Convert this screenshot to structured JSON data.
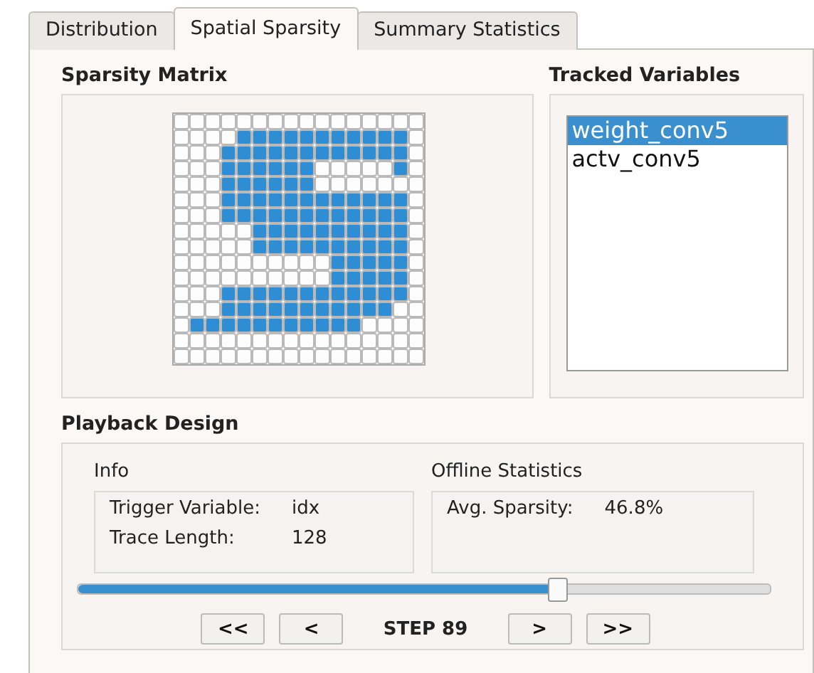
{
  "tabs": [
    {
      "label": "Distribution",
      "selected": false
    },
    {
      "label": "Spatial Sparsity",
      "selected": true
    },
    {
      "label": "Summary Statistics",
      "selected": false
    }
  ],
  "sparsity_matrix": {
    "title": "Sparsity Matrix",
    "cells": [
      [
        false,
        false,
        false,
        false,
        false,
        false,
        false,
        false,
        false,
        false,
        false,
        false,
        false,
        false,
        false,
        false
      ],
      [
        false,
        false,
        false,
        false,
        true,
        true,
        true,
        true,
        true,
        true,
        true,
        true,
        true,
        true,
        true,
        false
      ],
      [
        false,
        false,
        false,
        true,
        true,
        true,
        true,
        true,
        true,
        true,
        true,
        true,
        true,
        true,
        true,
        false
      ],
      [
        false,
        false,
        false,
        true,
        true,
        true,
        true,
        true,
        true,
        false,
        false,
        false,
        false,
        false,
        true,
        false
      ],
      [
        false,
        false,
        false,
        true,
        true,
        true,
        true,
        true,
        true,
        false,
        false,
        false,
        false,
        false,
        false,
        false
      ],
      [
        false,
        false,
        false,
        true,
        true,
        true,
        true,
        true,
        true,
        true,
        true,
        true,
        true,
        true,
        true,
        false
      ],
      [
        false,
        false,
        false,
        true,
        true,
        true,
        true,
        true,
        true,
        true,
        true,
        true,
        true,
        true,
        true,
        false
      ],
      [
        false,
        false,
        false,
        false,
        false,
        true,
        true,
        true,
        true,
        true,
        true,
        true,
        true,
        true,
        true,
        false
      ],
      [
        false,
        false,
        false,
        false,
        false,
        true,
        true,
        true,
        true,
        true,
        true,
        true,
        true,
        true,
        true,
        false
      ],
      [
        false,
        false,
        false,
        false,
        false,
        false,
        false,
        false,
        false,
        false,
        true,
        true,
        true,
        true,
        true,
        false
      ],
      [
        false,
        false,
        false,
        false,
        false,
        false,
        false,
        false,
        false,
        false,
        true,
        true,
        true,
        true,
        true,
        false
      ],
      [
        false,
        false,
        false,
        true,
        true,
        true,
        true,
        true,
        true,
        true,
        true,
        true,
        true,
        true,
        true,
        false
      ],
      [
        false,
        false,
        false,
        true,
        true,
        true,
        true,
        true,
        true,
        true,
        true,
        true,
        true,
        true,
        false,
        false
      ],
      [
        false,
        true,
        true,
        true,
        true,
        true,
        true,
        true,
        true,
        true,
        true,
        true,
        false,
        false,
        false,
        false
      ],
      [
        false,
        false,
        false,
        false,
        false,
        false,
        false,
        false,
        false,
        false,
        false,
        false,
        false,
        false,
        false,
        false
      ],
      [
        false,
        false,
        false,
        false,
        false,
        false,
        false,
        false,
        false,
        false,
        false,
        false,
        false,
        false,
        false,
        false
      ]
    ]
  },
  "tracked_variables": {
    "title": "Tracked Variables",
    "items": [
      {
        "label": "weight_conv5",
        "selected": true
      },
      {
        "label": "actv_conv5",
        "selected": false
      }
    ]
  },
  "playback": {
    "title": "Playback Design",
    "info": {
      "title": "Info",
      "rows": [
        {
          "label": "Trigger Variable:",
          "value": "idx"
        },
        {
          "label": "Trace Length:",
          "value": "128"
        }
      ]
    },
    "offline_statistics": {
      "title": "Offline Statistics",
      "rows": [
        {
          "label": "Avg. Sparsity:",
          "value": "46.8%"
        }
      ]
    },
    "slider": {
      "level": 0.69
    },
    "buttons": [
      "<<",
      "<"
    ],
    "step": "STEP 89",
    "buttons_after": [
      ">",
      ">>"
    ]
  }
}
